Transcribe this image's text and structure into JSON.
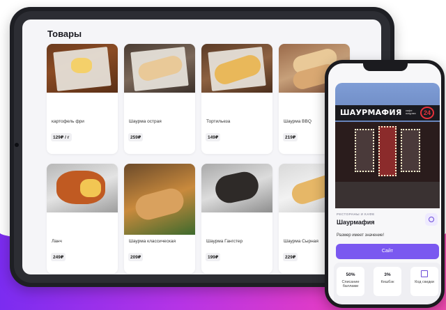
{
  "catalog": {
    "title": "Товары",
    "products": [
      {
        "name": "картофель фри",
        "price": "129₽ / г",
        "image": "fries"
      },
      {
        "name": "Шаурма острая",
        "price": "259₽",
        "image": "shawarma"
      },
      {
        "name": "Тортильеза",
        "price": "149₽",
        "image": "tortilla"
      },
      {
        "name": "Шаурма BBQ",
        "price": "219₽",
        "image": "bbq"
      },
      {
        "name": "Ланч",
        "price": "249₽",
        "image": "lunch"
      },
      {
        "name": "Шаурма классическая",
        "price": "209₽",
        "image": "classic"
      },
      {
        "name": "Шаурма Гангстер",
        "price": "199₽",
        "image": "gangster"
      },
      {
        "name": "Шаурма Сырная",
        "price": "229₽",
        "image": "cheese"
      }
    ]
  },
  "venue": {
    "sign": "ШАУРМАФИЯ",
    "sign_small": "кафе шаурма",
    "sign_badge": "24",
    "category": "РЕСТОРАНЫ И КАФЕ",
    "name": "Шаурмафия",
    "tagline": "Размер имеет значение!",
    "site_button": "Сайт",
    "stats": [
      {
        "value": "50%",
        "label": "Списание баллами"
      },
      {
        "value": "3%",
        "label": "Кешбэк"
      },
      {
        "value": "",
        "label": "Код скидки",
        "icon": "qr-code-icon"
      }
    ]
  },
  "colors": {
    "accent": "#7a58f0",
    "background_gradient": [
      "#7b2cf0",
      "#f04bb0"
    ],
    "badge_red": "#e8313a"
  }
}
